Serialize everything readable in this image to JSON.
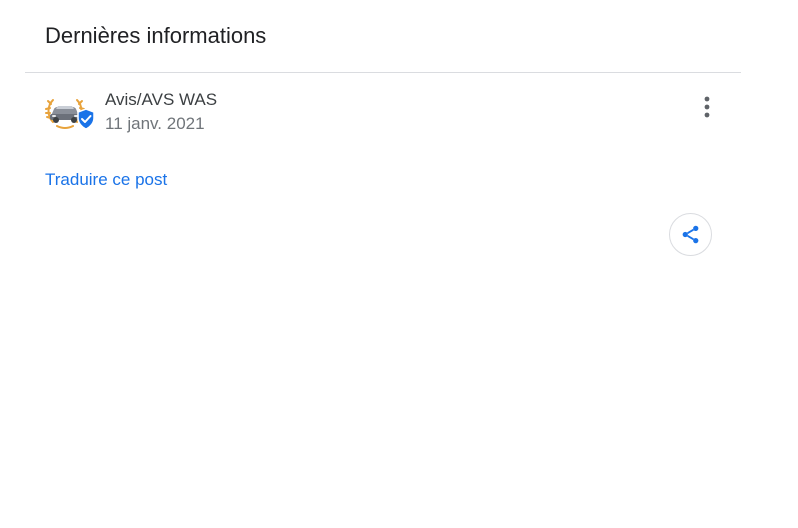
{
  "section": {
    "title": "Dernières informations"
  },
  "post": {
    "author": "Avis/AVS WAS",
    "date": "11 janv. 2021",
    "avatar_icon": "car-laurel-logo-icon",
    "verified_icon": "verified-badge-icon",
    "more_icon": "more-vert-icon",
    "translate_label": "Traduire ce post",
    "share_icon": "share-icon"
  },
  "colors": {
    "link": "#1a73e8",
    "verified": "#1a73e8",
    "divider": "#dadce0",
    "laurel": "#e8a33c"
  }
}
